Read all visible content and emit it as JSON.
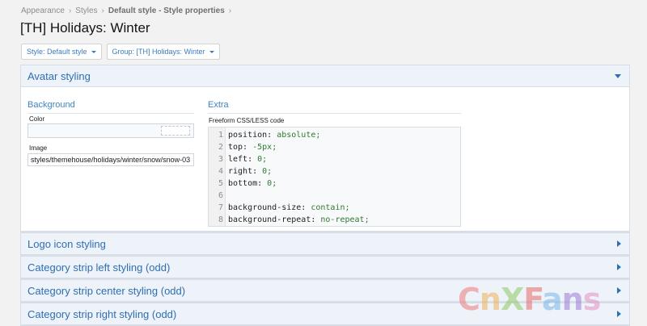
{
  "breadcrumb": {
    "items": [
      "Appearance",
      "Styles",
      "Default style - Style properties"
    ]
  },
  "page": {
    "title": "[TH] Holidays: Winter"
  },
  "filters": {
    "style": "Style: Default style",
    "group": "Group: [TH] Holidays: Winter"
  },
  "sections": [
    {
      "title": "Avatar styling",
      "expanded": true,
      "background": {
        "heading": "Background",
        "color_label": "Color",
        "color_value": "",
        "image_label": "Image",
        "image_value": "styles/themehouse/holidays/winter/snow/snow-03"
      },
      "extra": {
        "heading": "Extra",
        "code_label": "Freeform CSS/LESS code",
        "lines": [
          {
            "num": "1",
            "prop": "position:",
            "val": " absolute;"
          },
          {
            "num": "2",
            "prop": "top:",
            "val": " -5px;"
          },
          {
            "num": "3",
            "prop": "left:",
            "val": " 0;"
          },
          {
            "num": "4",
            "prop": "right:",
            "val": " 0;"
          },
          {
            "num": "5",
            "prop": "bottom:",
            "val": " 0;"
          },
          {
            "num": "6",
            "prop": "",
            "val": ""
          },
          {
            "num": "7",
            "prop": "background-size:",
            "val": " contain;"
          },
          {
            "num": "8",
            "prop": "background-repeat:",
            "val": " no-repeat;"
          }
        ]
      }
    },
    {
      "title": "Logo icon styling",
      "expanded": false
    },
    {
      "title": "Category strip left styling (odd)",
      "expanded": false
    },
    {
      "title": "Category strip center styling (odd)",
      "expanded": false
    },
    {
      "title": "Category strip right styling (odd)",
      "expanded": false
    }
  ],
  "watermark": {
    "letters": [
      "C",
      "n",
      "X",
      "F",
      "a",
      "n",
      "s"
    ],
    "colors": [
      "#ee7b7b",
      "#f1b35a",
      "#8fc964",
      "#e86a6a",
      "#7ab6e6",
      "#9b7bd8",
      "#e78fc6"
    ]
  },
  "colors": {
    "accent": "#2f6eb4",
    "header_bg": "#edf3f9",
    "code_value": "#2f7a2f"
  }
}
